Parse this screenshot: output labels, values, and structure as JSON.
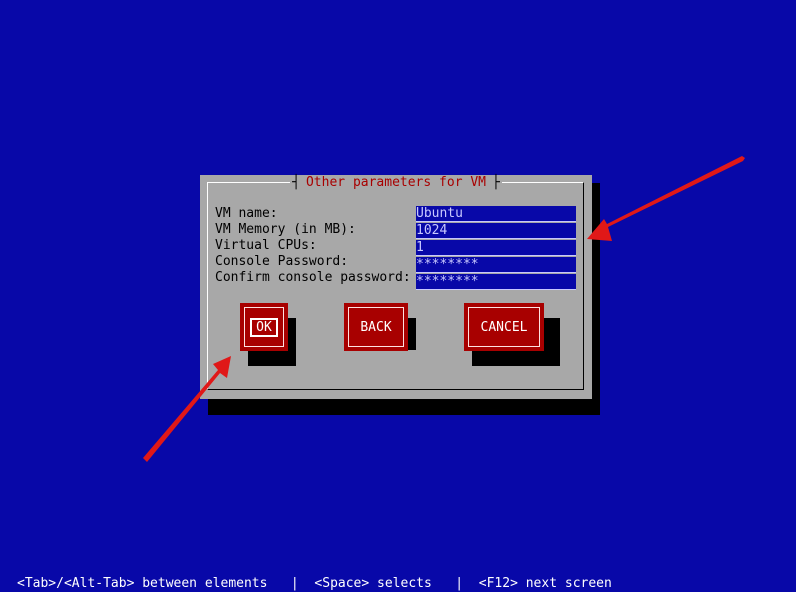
{
  "dialog": {
    "title": "Other parameters for VM",
    "fields": [
      {
        "label": "VM name:",
        "value": "Ubuntu"
      },
      {
        "label": "VM Memory (in MB):",
        "value": "1024"
      },
      {
        "label": "Virtual CPUs:",
        "value": "1"
      },
      {
        "label": "Console Password:",
        "value": "********"
      },
      {
        "label": "Confirm console password:",
        "value": "********"
      }
    ],
    "buttons": {
      "ok": "OK",
      "back": "BACK",
      "cancel": "CANCEL"
    }
  },
  "statusbar": {
    "text": "<Tab>/<Alt-Tab> between elements   |  <Space> selects   |  <F12> next screen"
  },
  "colors": {
    "background": "#0808a8",
    "dialog": "#a8a8a8",
    "button": "#a80000",
    "title_text": "#a80000",
    "annotation_arrow": "#e01818"
  }
}
